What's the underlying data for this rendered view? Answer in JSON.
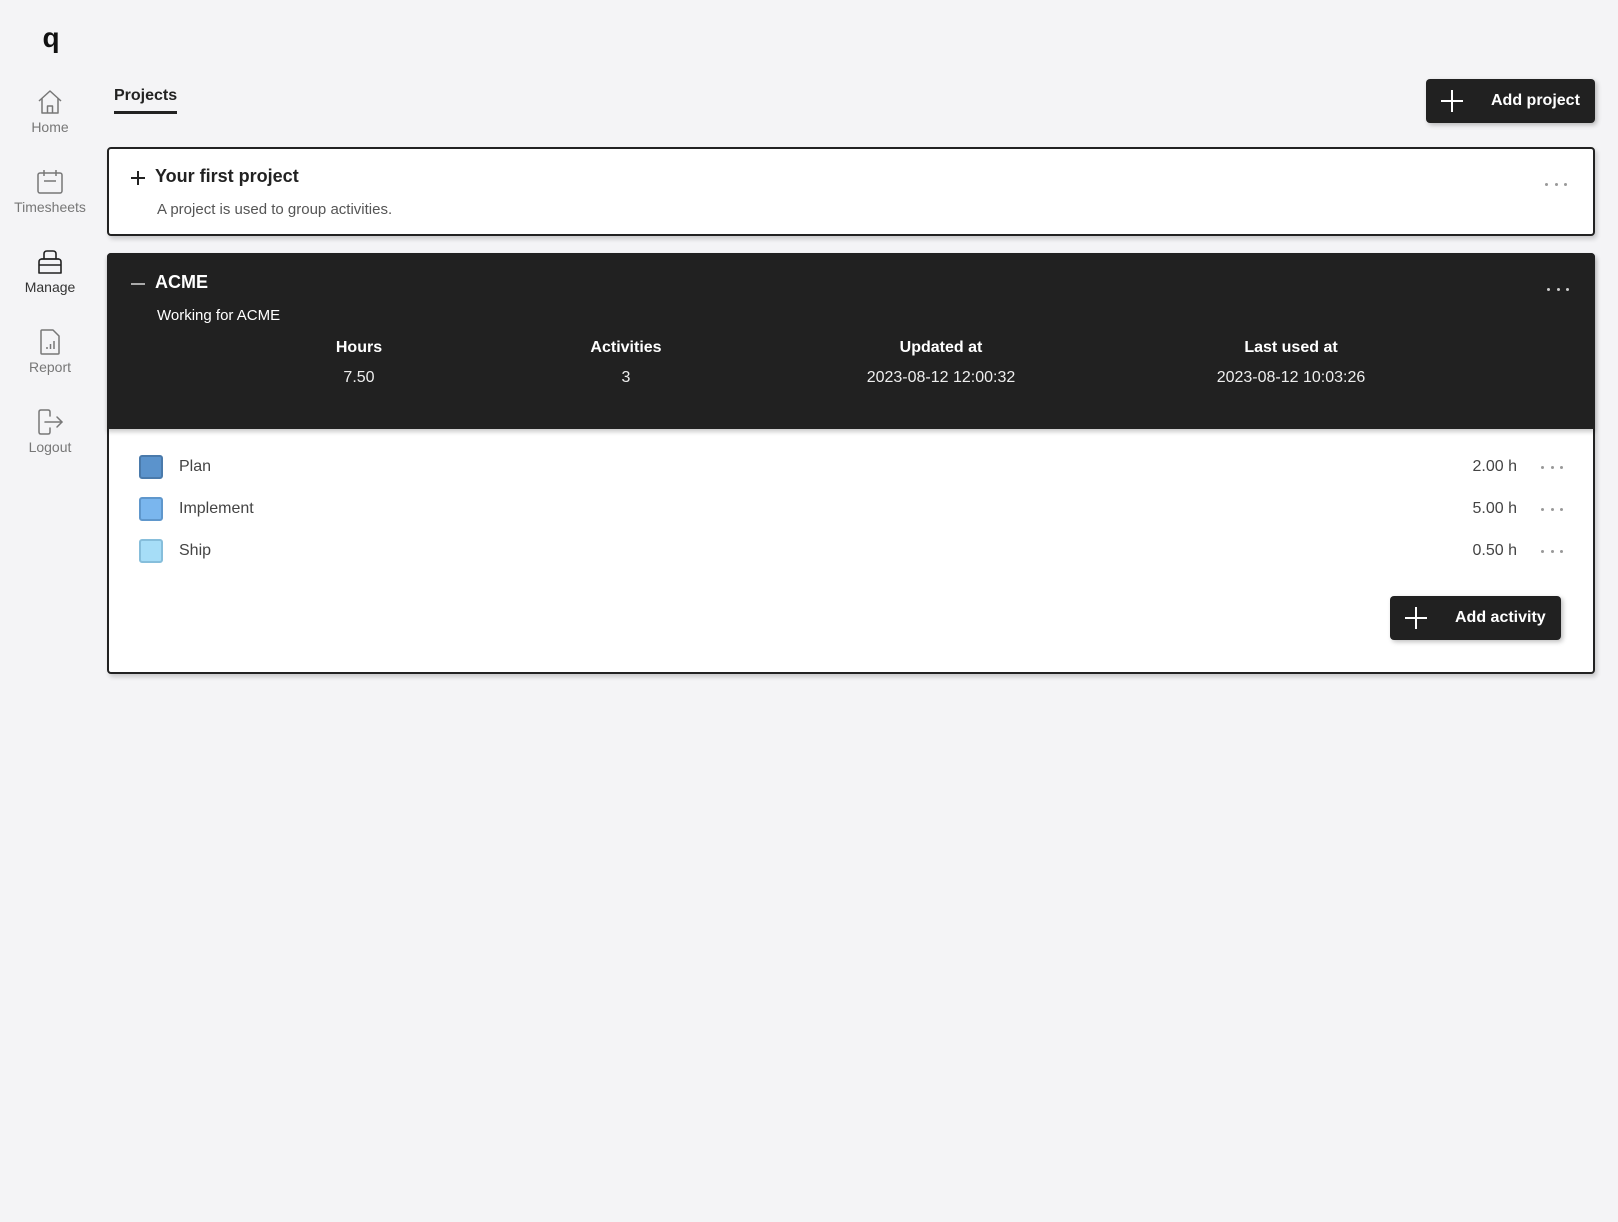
{
  "sidebar": {
    "logo": "q",
    "items": [
      {
        "label": "Home",
        "icon": "home-icon",
        "active": false
      },
      {
        "label": "Timesheets",
        "icon": "calendar-icon",
        "active": false
      },
      {
        "label": "Manage",
        "icon": "manage-icon",
        "active": true
      },
      {
        "label": "Report",
        "icon": "report-icon",
        "active": false
      },
      {
        "label": "Logout",
        "icon": "logout-icon",
        "active": false
      }
    ]
  },
  "header": {
    "tab": "Projects",
    "add_project_label": "Add project"
  },
  "projects": [
    {
      "title": "Your first project",
      "description": "A project is used to group activities.",
      "expanded": false
    },
    {
      "title": "ACME",
      "description": "Working for ACME",
      "expanded": true,
      "stats": [
        {
          "label": "Hours",
          "value": "7.50"
        },
        {
          "label": "Activities",
          "value": "3"
        },
        {
          "label": "Updated at",
          "value": "2023-08-12 12:00:32"
        },
        {
          "label": "Last used at",
          "value": "2023-08-12 10:03:26"
        }
      ],
      "activities": [
        {
          "name": "Plan",
          "hours": "2.00 h",
          "color": "#5b93cc",
          "border": "#4a7aab"
        },
        {
          "name": "Implement",
          "hours": "5.00 h",
          "color": "#7ab6ee",
          "border": "#5f97cc"
        },
        {
          "name": "Ship",
          "hours": "0.50 h",
          "color": "#a6ddf7",
          "border": "#86bedb"
        }
      ],
      "add_activity_label": "Add activity"
    }
  ],
  "colors": {
    "dark": "#212121",
    "background": "#f4f4f6"
  }
}
